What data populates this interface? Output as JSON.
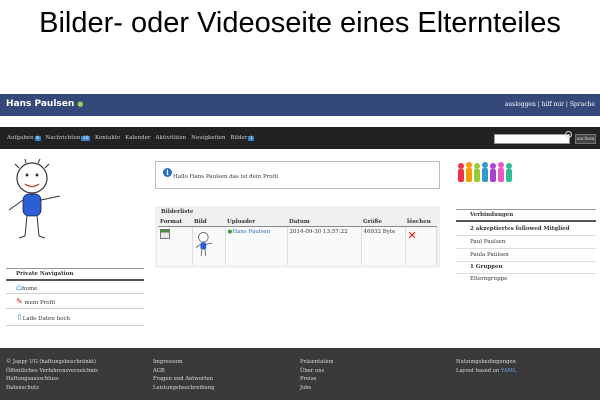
{
  "slide_title": "Bilder- oder Videoseite eines Elternteiles",
  "header": {
    "user_name": "Hans Paulsen",
    "dropdown_glyph": "●",
    "links": "ausloggen | hilf mir | Sprache"
  },
  "nav": {
    "items": [
      {
        "label": "Aufgaben",
        "badge": "4"
      },
      {
        "label": "Nachrichten",
        "badge": "10"
      },
      {
        "label": "Kontakte",
        "badge": ""
      },
      {
        "label": "Kalender",
        "badge": ""
      },
      {
        "label": "Aktivitäten",
        "badge": ""
      },
      {
        "label": "Neuigkeiten",
        "badge": ""
      },
      {
        "label": "Bilder",
        "badge": "1"
      }
    ],
    "search_placeholder": "",
    "search_button": "suchen"
  },
  "left": {
    "private_nav_title": "Private Navigation",
    "items": [
      "home",
      "mein Profil",
      "Lade Daten hoch"
    ]
  },
  "center": {
    "hello_text": "Hallo Hans Paulsen das ist dein Profil",
    "bilder_title": "Bilderliste",
    "columns": [
      "Format",
      "Bild",
      "Uploader",
      "Datum",
      "Größe",
      "löschen"
    ],
    "row": {
      "uploader": "Hans Paulsen",
      "datum": "2014-09-30 13:57:22",
      "groesse": "46932 Byte"
    }
  },
  "right": {
    "verbindungen_title": "Verbindungen",
    "items": [
      {
        "label": "2 akzeptiertes followed Mitglied",
        "bold": true
      },
      {
        "label": "Paul Paulsen",
        "bold": false
      },
      {
        "label": "Paula Paulsen",
        "bold": false
      },
      {
        "label": "1 Gruppen",
        "bold": true
      },
      {
        "label": "Elterngruppe",
        "bold": false
      }
    ]
  },
  "footer": {
    "col1": [
      "© Jappy UG (haftungsbeschränkt)",
      "Öffentliches Verfahrensverzeichnis",
      "Haftungsausschluss",
      "Datenschutz"
    ],
    "col2": [
      "Impressum",
      "AGB",
      "Fragen und Antworten",
      "Leistungsbeschreibung"
    ],
    "col3": [
      "Präsentation",
      "Über uns",
      "Preise",
      "Jobs"
    ],
    "col4_1": "Nutzungsbedingungen",
    "col4_2_prefix": "Layout based on",
    "col4_2_link": "YAML"
  },
  "colors": {
    "topbar": "#35487a",
    "navbar": "#222222",
    "badge": "#3a87c8",
    "footer": "#3a3a3a"
  }
}
